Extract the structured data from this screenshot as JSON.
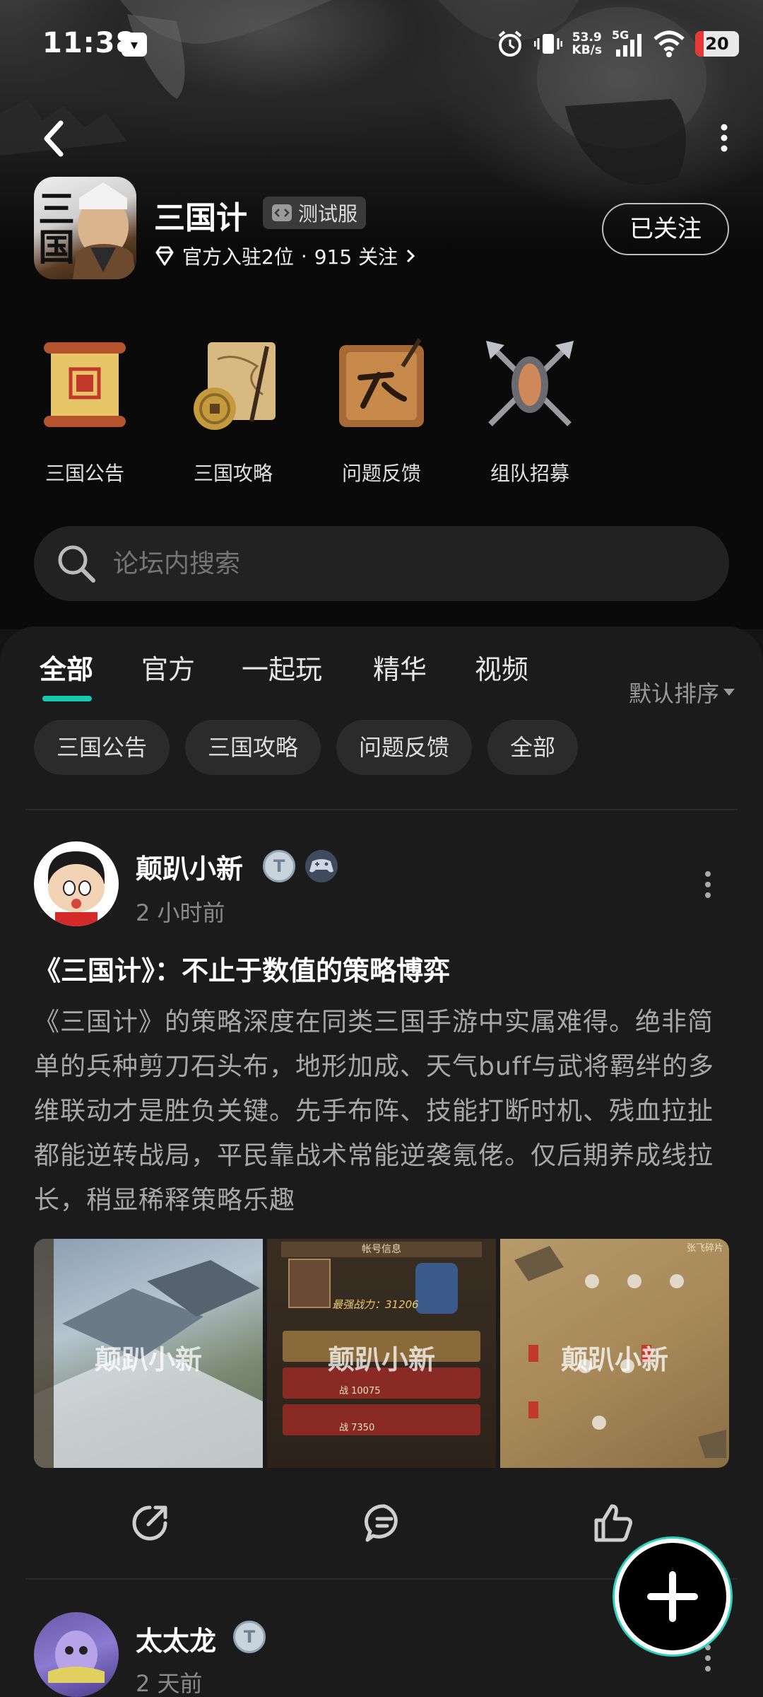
{
  "status_bar": {
    "time": "11:38",
    "net_speed_value": "53.9",
    "net_speed_unit": "KB/s",
    "network": "5G",
    "battery": "20"
  },
  "game": {
    "icon_text": "三国",
    "title": "三国计",
    "test_tag": "测试服",
    "rank_text": "官方入驻2位",
    "separator": "·",
    "followers_text": "915 关注",
    "follow_button": "已关注"
  },
  "quick_links": [
    {
      "label": "三国公告",
      "icon": "scroll-seal-icon"
    },
    {
      "label": "三国攻略",
      "icon": "map-coin-icon"
    },
    {
      "label": "问题反馈",
      "icon": "brush-board-icon"
    },
    {
      "label": "组队招募",
      "icon": "crossed-weapons-icon"
    }
  ],
  "search": {
    "placeholder": "论坛内搜索"
  },
  "tabs": [
    "全部",
    "官方",
    "一起玩",
    "精华",
    "视频"
  ],
  "sort_label": "默认排序",
  "chips": [
    "三国公告",
    "三国攻略",
    "问题反馈",
    "全部"
  ],
  "posts": [
    {
      "author": "颠趴小新",
      "time": "2 小时前",
      "title": "《三国计》：不止于数值的策略博弈",
      "body": "《三国计》的策略深度在同类三国手游中实属难得。绝非简单的兵种剪刀石头布，地形加成、天气buff与武将羁绊的多维联动才是胜负关键。先手布阵、技能打断时机、残血拉扯都能逆转战局，平民靠战术常能逆袭氪佬。仅后期养成线拉长，稍显稀释策略乐趣",
      "watermark": "颠趴小新",
      "screenshot_texts": {
        "img2_header": "帐号信息",
        "img2_power": "最强战力：31206",
        "img2_row1_power": "战 10075",
        "img2_row2_power": "战 7350",
        "img3_header": "张飞碎片"
      }
    },
    {
      "author": "太太龙",
      "time": "2 天前"
    }
  ],
  "colors": {
    "accent": "#19c8b0",
    "panel": "#1b1b1b",
    "chip": "#2b2b2b",
    "search": "#222222"
  }
}
